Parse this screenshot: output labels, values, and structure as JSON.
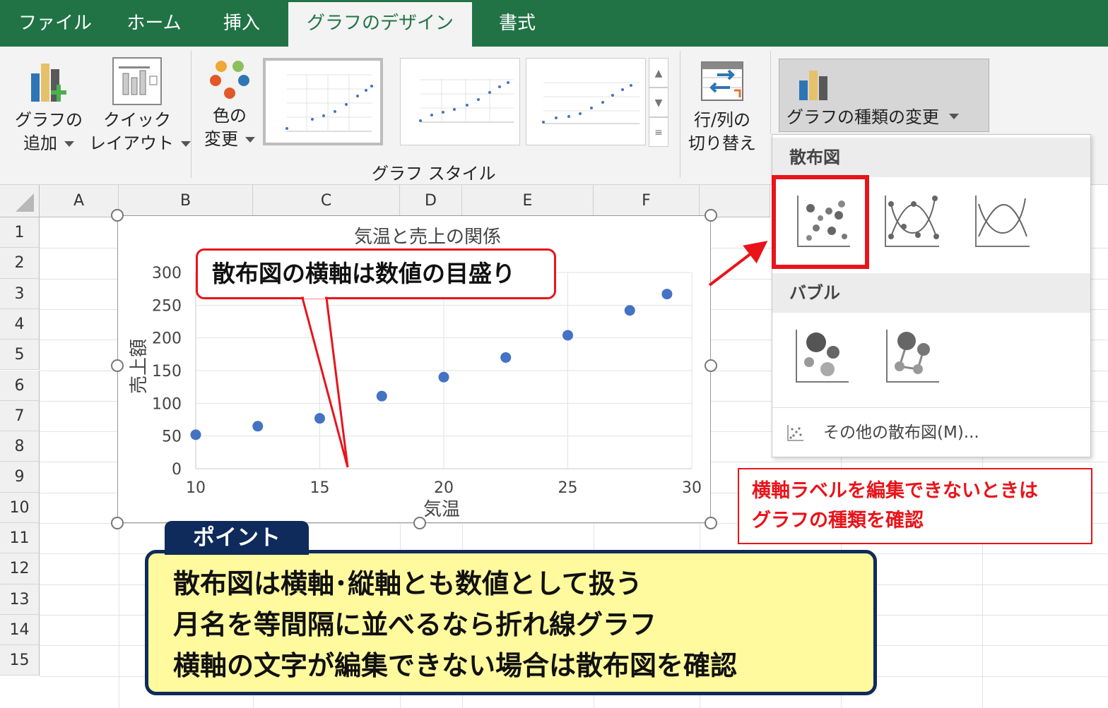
{
  "tabs": [
    "ファイル",
    "ホーム",
    "挿入",
    "グラフのデザイン",
    "書式"
  ],
  "ribbon": {
    "add_element": [
      "グラフの",
      "追加"
    ],
    "quick_layout": [
      "クイック",
      "レイアウト"
    ],
    "change_colors": [
      "色の",
      "変更"
    ],
    "chart_styles_label": "グラフ スタイル",
    "switch_row_col": [
      "行/列の",
      "切り替え"
    ],
    "change_chart_type": "グラフの種類の変更"
  },
  "columns": [
    "A",
    "B",
    "C",
    "D",
    "E",
    "F"
  ],
  "rows": [
    "1",
    "2",
    "3",
    "4",
    "5",
    "6",
    "7",
    "8",
    "9",
    "10",
    "11",
    "12",
    "13",
    "14",
    "15"
  ],
  "chart_data": {
    "type": "scatter",
    "title": "気温と売上の関係",
    "xlabel": "気温",
    "ylabel": "売上額",
    "xlim": [
      10,
      30
    ],
    "ylim": [
      0,
      300
    ],
    "x_ticks": [
      10,
      15,
      20,
      25,
      30
    ],
    "y_ticks": [
      0,
      50,
      100,
      150,
      200,
      250,
      300
    ],
    "grid": true,
    "color": "#4472c4",
    "points": [
      {
        "x": 10,
        "y": 52
      },
      {
        "x": 12.5,
        "y": 65
      },
      {
        "x": 15,
        "y": 77
      },
      {
        "x": 17.5,
        "y": 111
      },
      {
        "x": 20,
        "y": 140
      },
      {
        "x": 22.5,
        "y": 170
      },
      {
        "x": 25,
        "y": 204
      },
      {
        "x": 27.5,
        "y": 242
      },
      {
        "x": 29,
        "y": 267
      }
    ]
  },
  "callout_axis": "散布図の横軸は数値の目盛り",
  "note_red": [
    "横軸ラベルを編集できないときは",
    "グラフの種類を確認"
  ],
  "point": {
    "tag": "ポイント",
    "lines": [
      "散布図は横軸･縦軸とも数値として扱う",
      "月名を等間隔に並べるなら折れ線グラフ",
      "横軸の文字が編集できない場合は散布図を確認"
    ]
  },
  "dropdown": {
    "section_scatter": "散布図",
    "section_bubble": "バブル",
    "more": "その他の散布図(M)..."
  },
  "colors": {
    "excel_green": "#217346",
    "accent_red": "#e8141a",
    "navy": "#0f2b5b",
    "highlight_yellow": "#fffa9e"
  }
}
